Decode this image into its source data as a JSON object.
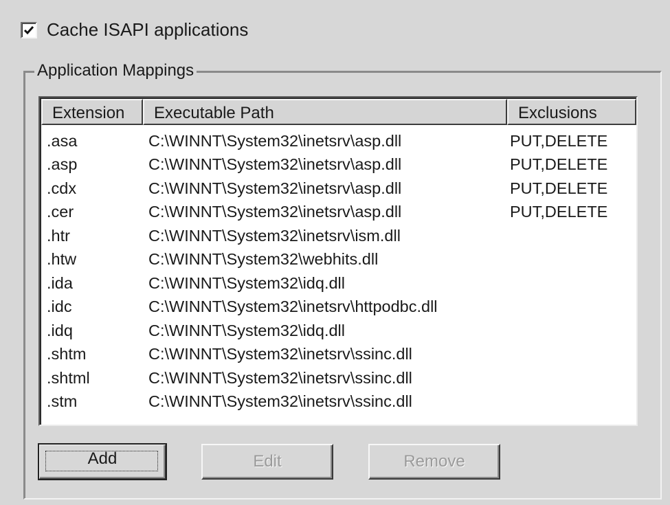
{
  "cache_isapi": {
    "label": "Cache ISAPI applications",
    "checked": true
  },
  "group": {
    "title": "Application Mappings"
  },
  "table": {
    "columns": [
      "Extension",
      "Executable Path",
      "Exclusions"
    ],
    "rows": [
      [
        ".asa",
        "C:\\WINNT\\System32\\inetsrv\\asp.dll",
        "PUT,DELETE"
      ],
      [
        ".asp",
        "C:\\WINNT\\System32\\inetsrv\\asp.dll",
        "PUT,DELETE"
      ],
      [
        ".cdx",
        "C:\\WINNT\\System32\\inetsrv\\asp.dll",
        "PUT,DELETE"
      ],
      [
        ".cer",
        "C:\\WINNT\\System32\\inetsrv\\asp.dll",
        "PUT,DELETE"
      ],
      [
        ".htr",
        "C:\\WINNT\\System32\\inetsrv\\ism.dll",
        ""
      ],
      [
        ".htw",
        "C:\\WINNT\\System32\\webhits.dll",
        ""
      ],
      [
        ".ida",
        "C:\\WINNT\\System32\\idq.dll",
        ""
      ],
      [
        ".idc",
        "C:\\WINNT\\System32\\inetsrv\\httpodbc.dll",
        ""
      ],
      [
        ".idq",
        "C:\\WINNT\\System32\\idq.dll",
        ""
      ],
      [
        ".shtm",
        "C:\\WINNT\\System32\\inetsrv\\ssinc.dll",
        ""
      ],
      [
        ".shtml",
        "C:\\WINNT\\System32\\inetsrv\\ssinc.dll",
        ""
      ],
      [
        ".stm",
        "C:\\WINNT\\System32\\inetsrv\\ssinc.dll",
        ""
      ]
    ]
  },
  "buttons": {
    "add": "Add",
    "edit": "Edit",
    "remove": "Remove"
  },
  "icons": {
    "checkbox": "checkmark-icon"
  }
}
